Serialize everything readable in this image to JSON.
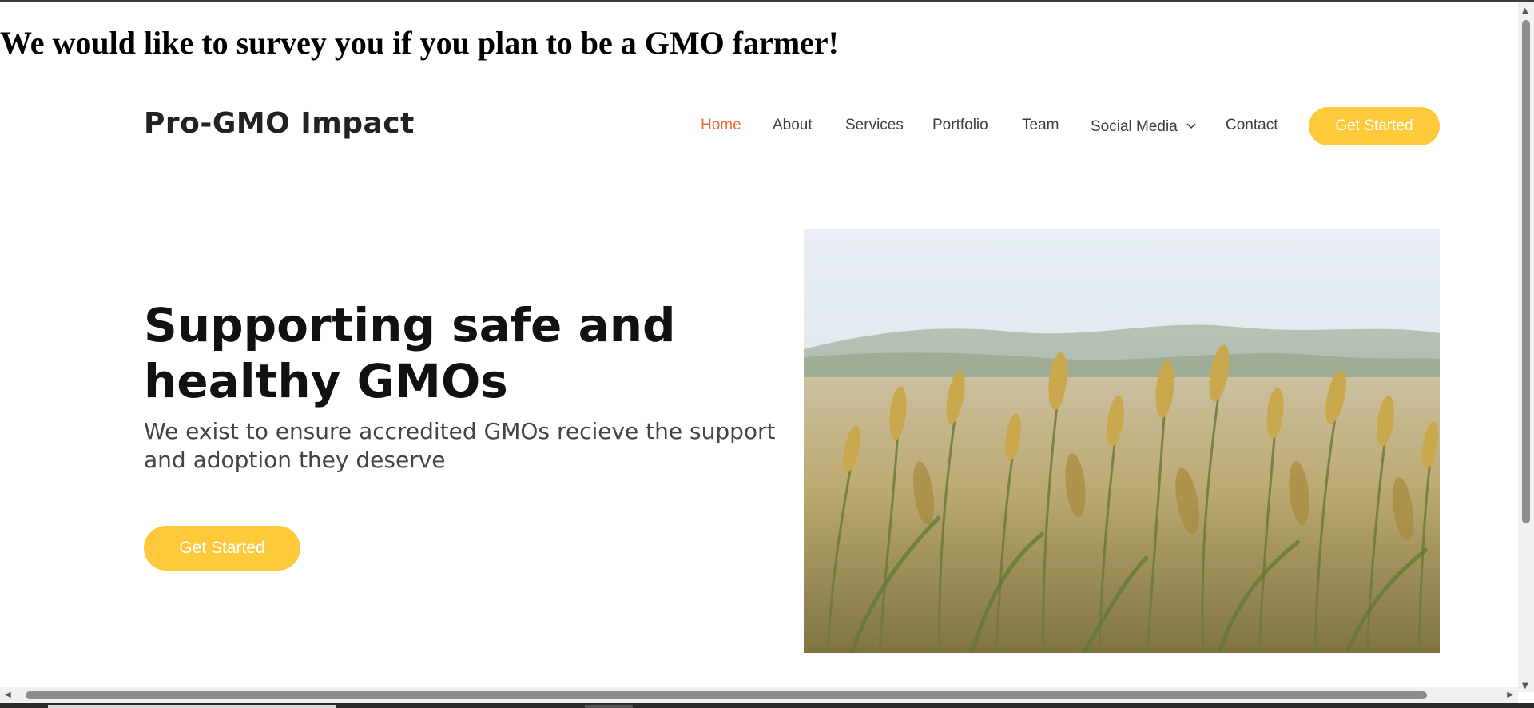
{
  "banner": {
    "text": "We would like to survey you if you plan to be a GMO farmer!"
  },
  "header": {
    "logo": "Pro-GMO Impact",
    "nav": [
      {
        "label": "Home",
        "active": true
      },
      {
        "label": "About"
      },
      {
        "label": "Services"
      },
      {
        "label": "Portfolio"
      },
      {
        "label": "Team"
      },
      {
        "label": "Social Media",
        "dropdown": true
      },
      {
        "label": "Contact"
      }
    ],
    "cta_label": "Get Started"
  },
  "hero": {
    "title_line1": "Supporting safe and",
    "title_line2": "healthy GMOs",
    "subtitle": "We exist to ensure accredited GMOs recieve the support and adoption they deserve",
    "cta_label": "Get Started",
    "image": "wheat-field-photo"
  },
  "colors": {
    "accent": "#ffc93c",
    "nav_active": "#e96b32",
    "text_dark": "#111111",
    "text_muted": "#444444"
  }
}
